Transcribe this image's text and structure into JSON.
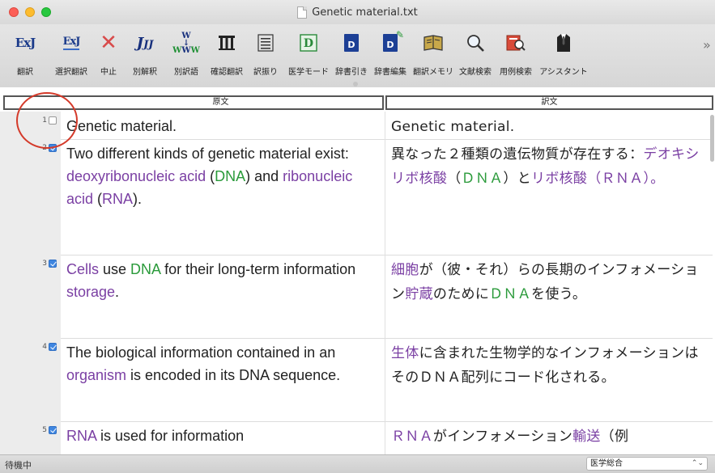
{
  "window": {
    "title": "Genetic material.txt"
  },
  "toolbar": {
    "buttons": [
      {
        "id": "translate",
        "label": "翻訳",
        "icon": "exj-icon",
        "glyph": "ExJ"
      },
      {
        "id": "select-translate",
        "label": "選択翻訳",
        "icon": "exj-select-icon",
        "glyph": "ExJ"
      },
      {
        "id": "stop",
        "label": "中止",
        "icon": "stop-x-icon",
        "glyph": "✕"
      },
      {
        "id": "alt-translate",
        "label": "別解釈",
        "icon": "jjj-icon",
        "glyph": "JJJ"
      },
      {
        "id": "alt-words",
        "label": "別訳語",
        "icon": "www-icon",
        "glyph": "W"
      },
      {
        "id": "confirm-translate",
        "label": "確認翻訳",
        "icon": "columns-icon",
        "glyph": "Ⅲ"
      },
      {
        "id": "furigana",
        "label": "訳振り",
        "icon": "lines-icon",
        "glyph": "☰"
      },
      {
        "id": "medical-mode",
        "label": "医学モード",
        "icon": "medical-d-icon",
        "glyph": "D"
      },
      {
        "id": "dict-lookup",
        "label": "辞書引き",
        "icon": "dictionary-icon",
        "glyph": "D"
      },
      {
        "id": "dict-edit",
        "label": "辞書編集",
        "icon": "dictionary-edit-icon",
        "glyph": "D"
      },
      {
        "id": "memo",
        "label": "翻訳メモリ",
        "icon": "memory-book-icon",
        "glyph": "📒"
      },
      {
        "id": "doc-search",
        "label": "文献検索",
        "icon": "magnifier-icon",
        "glyph": "🔍"
      },
      {
        "id": "example-search",
        "label": "用例検索",
        "icon": "example-search-icon",
        "glyph": "🔎"
      },
      {
        "id": "assistant",
        "label": "アシスタント",
        "icon": "assistant-icon",
        "glyph": "👔"
      }
    ],
    "more": "»"
  },
  "columns": {
    "number": "",
    "source": "原文",
    "target": "訳文"
  },
  "rows": [
    {
      "num": "1",
      "checked": false,
      "source": [
        {
          "t": "Genetic material."
        }
      ],
      "target": [
        {
          "t": "Genetic material."
        }
      ]
    },
    {
      "num": "2",
      "checked": true,
      "source": [
        {
          "t": "Two different kinds of genetic material exist: "
        },
        {
          "t": "deoxyribonucleic acid",
          "c": "purple"
        },
        {
          "t": " ("
        },
        {
          "t": "DNA",
          "c": "green"
        },
        {
          "t": ") and "
        },
        {
          "t": "ribonucleic acid",
          "c": "purple"
        },
        {
          "t": " ("
        },
        {
          "t": "RNA",
          "c": "purple"
        },
        {
          "t": ")."
        }
      ],
      "target": [
        {
          "t": "異なった２種類の遺伝物質が存在する："
        },
        {
          "t": "デオキシリボ核酸",
          "c": "purple"
        },
        {
          "t": "（"
        },
        {
          "t": "ＤＮＡ",
          "c": "green"
        },
        {
          "t": "）と"
        },
        {
          "t": "リボ核酸",
          "c": "purple"
        },
        {
          "t": "（ＲＮＡ）。",
          "c": "purple"
        }
      ]
    },
    {
      "num": "3",
      "checked": true,
      "source": [
        {
          "t": "Cells",
          "c": "purple"
        },
        {
          "t": " use "
        },
        {
          "t": "DNA",
          "c": "green"
        },
        {
          "t": " for their long-term information "
        },
        {
          "t": "storage",
          "c": "purple"
        },
        {
          "t": "."
        }
      ],
      "target": [
        {
          "t": "細胞",
          "c": "purple"
        },
        {
          "t": "が（彼・それ）らの長期のインフォメーション"
        },
        {
          "t": "貯蔵",
          "c": "purple"
        },
        {
          "t": "のために"
        },
        {
          "t": "ＤＮＡ",
          "c": "green"
        },
        {
          "t": "を使う。"
        }
      ]
    },
    {
      "num": "4",
      "checked": true,
      "source": [
        {
          "t": "The biological information contained in an "
        },
        {
          "t": "organism",
          "c": "purple"
        },
        {
          "t": " is encoded in its DNA sequence."
        }
      ],
      "target": [
        {
          "t": "生体",
          "c": "purple"
        },
        {
          "t": "に含まれた生物学的なインフォメーションはそのＤＮＡ配列にコード化される。"
        }
      ]
    },
    {
      "num": "5",
      "checked": true,
      "source": [
        {
          "t": "RNA",
          "c": "purple"
        },
        {
          "t": " is used for information"
        }
      ],
      "target": [
        {
          "t": "ＲＮＡ",
          "c": "purple"
        },
        {
          "t": "がインフォメーション"
        },
        {
          "t": "輸送",
          "c": "purple"
        },
        {
          "t": "（例"
        }
      ]
    }
  ],
  "status": {
    "text": "待機中",
    "dictionary": "医学総合",
    "dictionary_arrows": "⌃⌄"
  },
  "colors": {
    "purple": "#7a3fa3",
    "green": "#2a9a3a",
    "annotation_circle": "#d43a2a"
  }
}
